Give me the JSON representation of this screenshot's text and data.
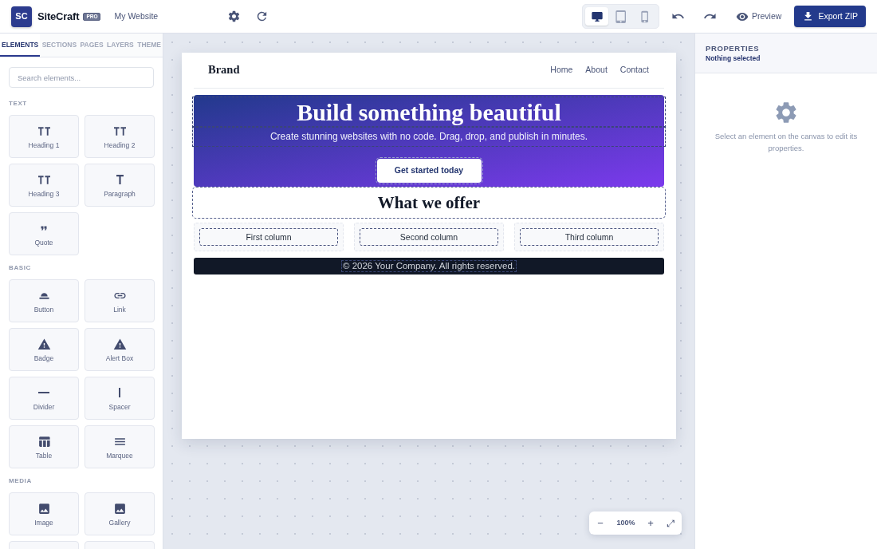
{
  "top_bar": {
    "logo": "SC",
    "app_name": "SiteCraft",
    "plan_badge": "PRO",
    "project_name": "My Website",
    "devices": [
      {
        "selected": true
      },
      {
        "selected": false
      },
      {
        "selected": false
      }
    ],
    "preview_button": "Preview",
    "export_button": "Export ZIP"
  },
  "sidebar": {
    "tabs": [
      {
        "label": "ELEMENTS",
        "selected": true
      },
      {
        "label": "SECTIONS",
        "selected": false
      },
      {
        "label": "PAGES",
        "selected": false
      },
      {
        "label": "LAYERS",
        "selected": false
      },
      {
        "label": "THEME",
        "selected": false
      }
    ],
    "search": {
      "placeholder": "Search elements..."
    },
    "sections": [
      {
        "title": "TEXT",
        "items": [
          {
            "kind": "element",
            "label": "Heading 1"
          },
          {
            "kind": "element",
            "label": "Heading 2"
          },
          {
            "kind": "element",
            "label": "Heading 3"
          },
          {
            "kind": "element",
            "label": "Paragraph"
          },
          {
            "kind": "element",
            "label": "Quote"
          }
        ]
      },
      {
        "title": "BASIC",
        "items": [
          {
            "kind": "element",
            "label": "Button"
          },
          {
            "kind": "element",
            "label": "Link"
          },
          {
            "kind": "element",
            "label": "Badge"
          },
          {
            "kind": "element",
            "label": "Alert Box"
          },
          {
            "kind": "element",
            "label": "Divider"
          },
          {
            "kind": "element",
            "label": "Spacer"
          },
          {
            "kind": "element",
            "label": "Table"
          },
          {
            "kind": "element",
            "label": "Marquee"
          }
        ]
      },
      {
        "title": "MEDIA",
        "items": [
          {
            "kind": "element",
            "label": "Image"
          },
          {
            "kind": "element",
            "label": "Gallery"
          },
          {
            "kind": "cut_off"
          },
          {
            "kind": "cut_off"
          }
        ]
      }
    ]
  },
  "canvas": {
    "page": {
      "brand": "Brand",
      "nav": [
        "Home",
        "About",
        "Contact"
      ],
      "hero": {
        "title": "Build something beautiful",
        "subtitle": "Create stunning websites with no code. Drag, drop, and publish in minutes.",
        "button": "Get started today"
      },
      "section_title": "What we offer",
      "columns": [
        "First column",
        "Second column",
        "Third column"
      ],
      "footer": "© 2026 Your Company. All rights reserved."
    },
    "zoom_controls": {
      "zoom_out": "−",
      "zoom_value": "100%",
      "zoom_in": "+",
      "fit": "⤢"
    }
  },
  "properties": {
    "title": "PROPERTIES",
    "subtitle": "Nothing selected",
    "hint": "Select an element on the canvas to edit its properties."
  }
}
